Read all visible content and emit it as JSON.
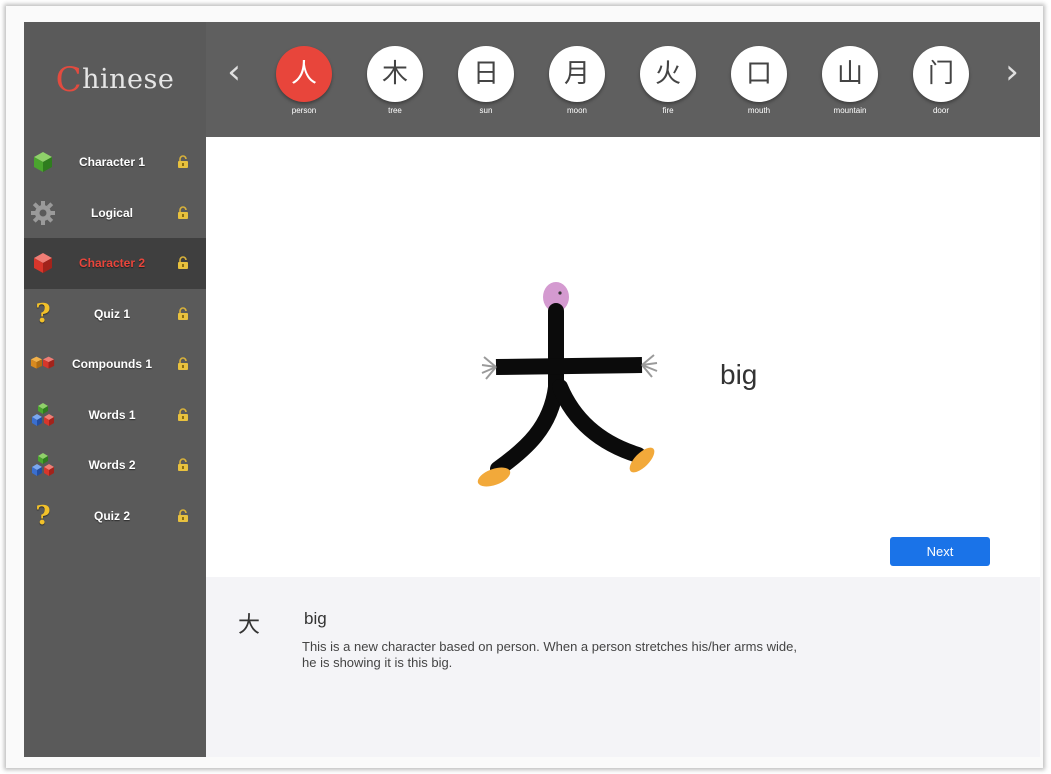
{
  "app": {
    "logo_first": "C",
    "logo_rest": "hinese"
  },
  "sidebar": {
    "items": [
      {
        "label": "Character 1",
        "icon": "green-cube-icon",
        "active": false
      },
      {
        "label": "Logical",
        "icon": "gear-icon",
        "active": false
      },
      {
        "label": "Character 2",
        "icon": "red-cube-icon",
        "active": true
      },
      {
        "label": "Quiz 1",
        "icon": "question-icon",
        "active": false
      },
      {
        "label": "Compounds 1",
        "icon": "compound-cubes-icon",
        "active": false
      },
      {
        "label": "Words 1",
        "icon": "stacked-cubes-icon",
        "active": false
      },
      {
        "label": "Words 2",
        "icon": "stacked-cubes-icon",
        "active": false
      },
      {
        "label": "Quiz 2",
        "icon": "question-icon",
        "active": false
      }
    ]
  },
  "topbar": {
    "characters": [
      {
        "char": "人",
        "label": "person",
        "active": true
      },
      {
        "char": "木",
        "label": "tree",
        "active": false
      },
      {
        "char": "日",
        "label": "sun",
        "active": false
      },
      {
        "char": "月",
        "label": "moon",
        "active": false
      },
      {
        "char": "火",
        "label": "fire",
        "active": false
      },
      {
        "char": "口",
        "label": "mouth",
        "active": false
      },
      {
        "char": "山",
        "label": "mountain",
        "active": false
      },
      {
        "char": "门",
        "label": "door",
        "active": false
      }
    ],
    "prev_glyph": "‹",
    "next_glyph": "›"
  },
  "main": {
    "meaning": "big",
    "next_label": "Next"
  },
  "description": {
    "char": "大",
    "word": "big",
    "text": "This is a new character based on person. When a person stretches his/her arms wide, he is showing it is this big."
  },
  "colors": {
    "accent": "#e8453b",
    "sidebar_bg": "#5a5a5a",
    "topbar_bg": "#5f5f5f",
    "button_blue": "#1a73e8"
  }
}
